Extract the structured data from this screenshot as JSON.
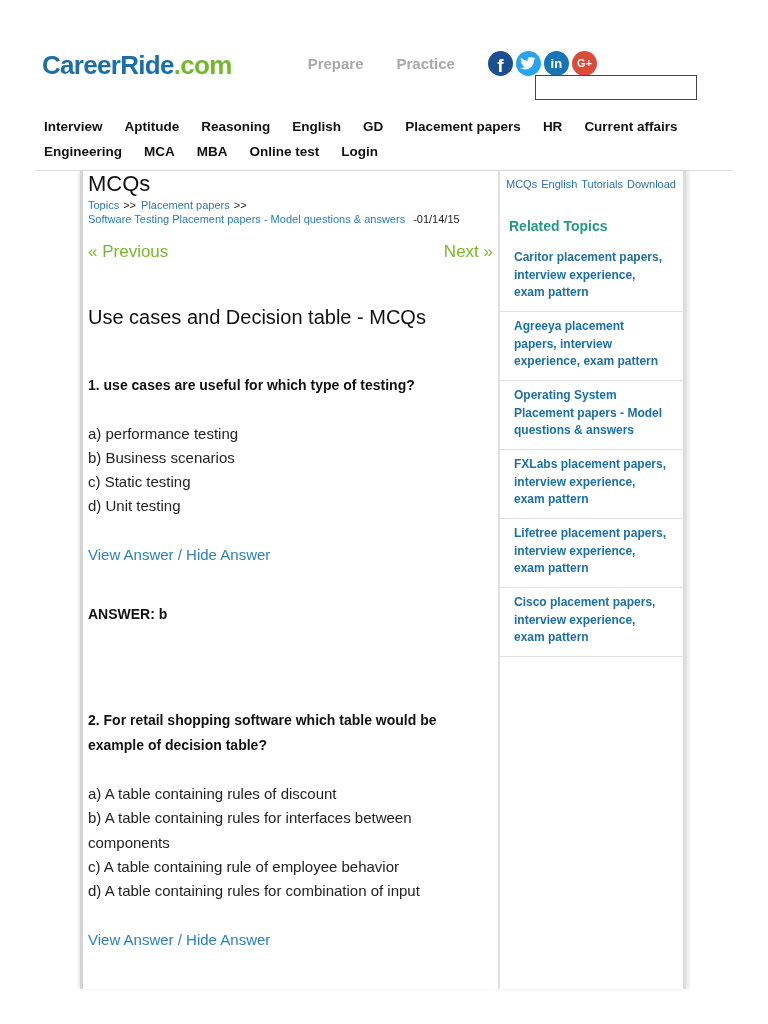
{
  "header": {
    "logo": {
      "name": "CareerRide",
      "suffix": ".com"
    },
    "links": [
      "Prepare",
      "Practice"
    ],
    "social": [
      {
        "kind": "facebook",
        "glyph": "f"
      },
      {
        "kind": "twitter"
      },
      {
        "kind": "linkedin",
        "glyph": "in"
      },
      {
        "kind": "google_plus",
        "glyph": "G+"
      }
    ]
  },
  "nav": {
    "rows": [
      [
        "Interview",
        "Aptitude",
        "Reasoning",
        "English",
        "GD",
        "Placement papers",
        "HR",
        "Current affairs"
      ],
      [
        "Engineering",
        "MCA",
        "MBA",
        "Online test",
        "Login"
      ]
    ]
  },
  "article": {
    "section": "MCQs",
    "breadcrumb": {
      "trail": [
        {
          "label": "Topics",
          "separator": ">>"
        },
        {
          "label": "Placement papers",
          "separator": ">>"
        }
      ],
      "page": {
        "label": "Software Testing Placement papers - Model questions & answers",
        "date": "-01/14/15"
      }
    },
    "pager": {
      "previous": "« Previous",
      "next": "Next »"
    },
    "title": "Use cases and Decision table - MCQs",
    "questions": [
      {
        "question": "1. use cases are useful for which type of testing?",
        "options": [
          "a) performance testing",
          "b) Business scenarios",
          "c) Static testing",
          "d) Unit testing"
        ],
        "toggle": "View Answer / Hide Answer",
        "answer": "ANSWER: b"
      },
      {
        "question": "2. For retail shopping software which table would be example of decision table?",
        "options": [
          "a) A table containing rules of discount",
          "b) A table containing rules for interfaces between components",
          "c) A table containing rule of employee behavior",
          "d) A table containing rules for combination of input"
        ],
        "toggle": "View Answer / Hide Answer"
      }
    ]
  },
  "sidebar": {
    "tabs": [
      "MCQs",
      "English",
      "Tutorials",
      "Download"
    ],
    "heading": "Related Topics",
    "items": [
      "Caritor placement papers, interview experience, exam pattern",
      "Agreeya placement papers, interview experience, exam pattern",
      "Operating System Placement papers - Model questions & answers",
      "FXLabs placement papers, interview experience, exam pattern",
      "Lifetree placement papers, interview experience, exam pattern",
      "Cisco placement papers, interview experience, exam pattern"
    ]
  }
}
